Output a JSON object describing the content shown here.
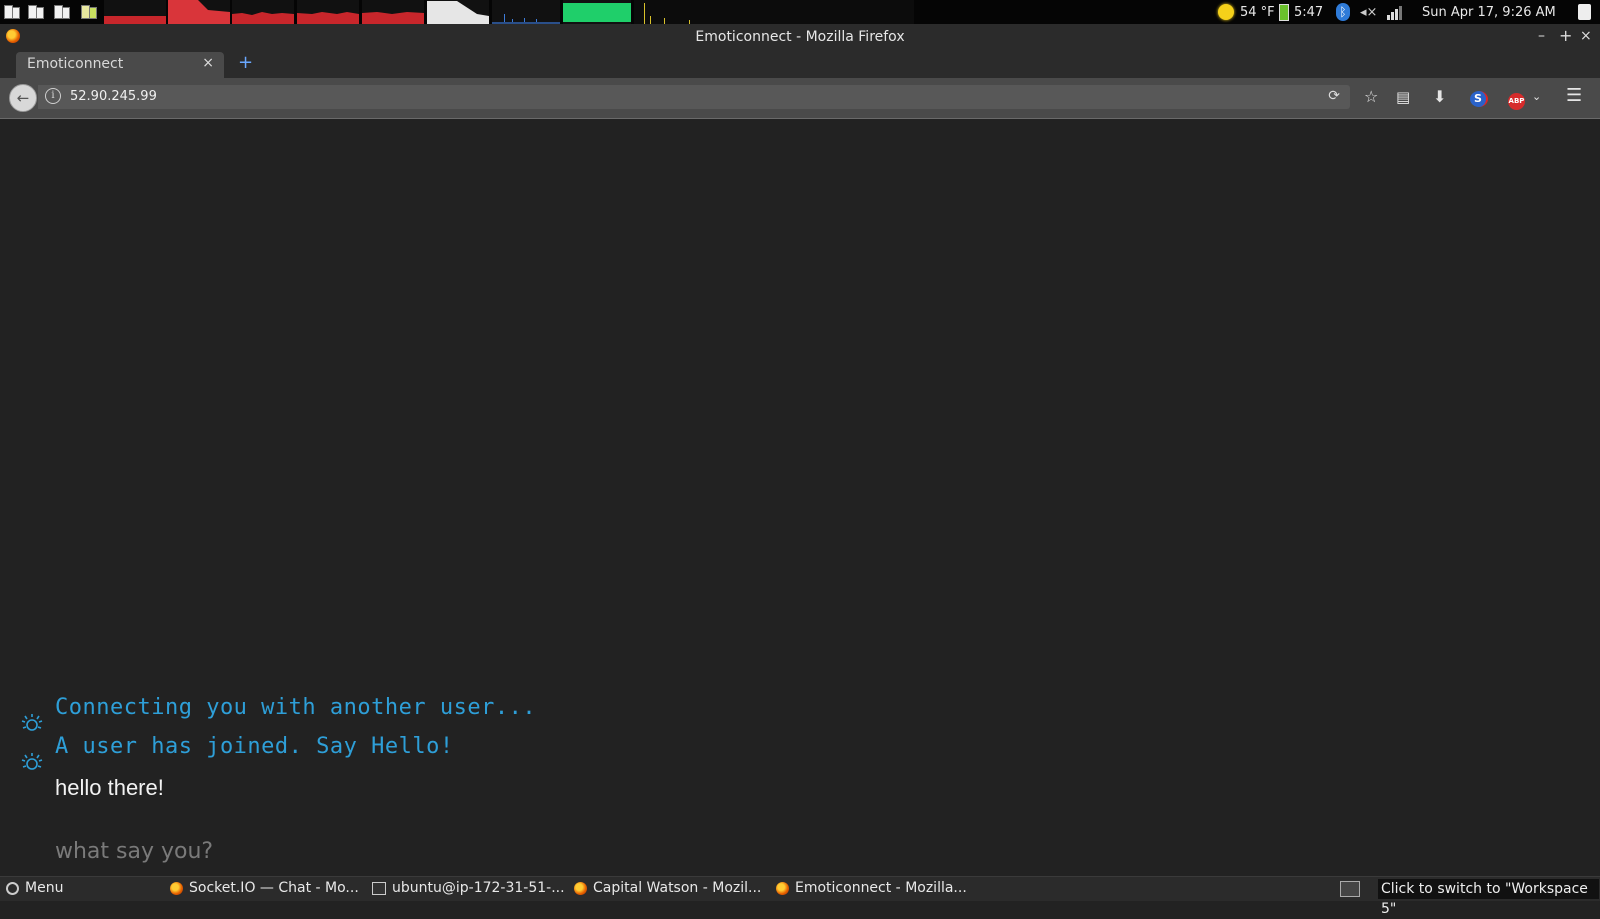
{
  "system_panel": {
    "weather": "54 °F",
    "battery": "5:47",
    "datetime": "Sun Apr 17,  9:26 AM"
  },
  "window": {
    "title": "Emoticonnect - Mozilla Firefox",
    "minimize": "–",
    "maximize": "+",
    "close": "×"
  },
  "tabs": [
    {
      "label": "Emoticonnect",
      "close": "×"
    }
  ],
  "new_tab": "+",
  "navbar": {
    "url": "52.90.245.99",
    "info": "i"
  },
  "chat": {
    "system_messages": [
      "Connecting you with another user...",
      "A user has joined. Say Hello!"
    ],
    "messages": [
      "hello there!"
    ],
    "input_placeholder": "what say you?"
  },
  "taskbar": {
    "menu_label": "Menu",
    "tasks": [
      "Socket.IO — Chat - Mo...",
      "ubuntu@ip-172-31-51-...",
      "Capital Watson - Mozil...",
      "Emoticonnect - Mozilla..."
    ],
    "tooltip": "Click to switch to \"Workspace 5\""
  },
  "colors": {
    "background": "#222222",
    "system_message": "#2e9fd8",
    "chat_text": "#f2f2f2",
    "placeholder": "#7a7a7a"
  }
}
